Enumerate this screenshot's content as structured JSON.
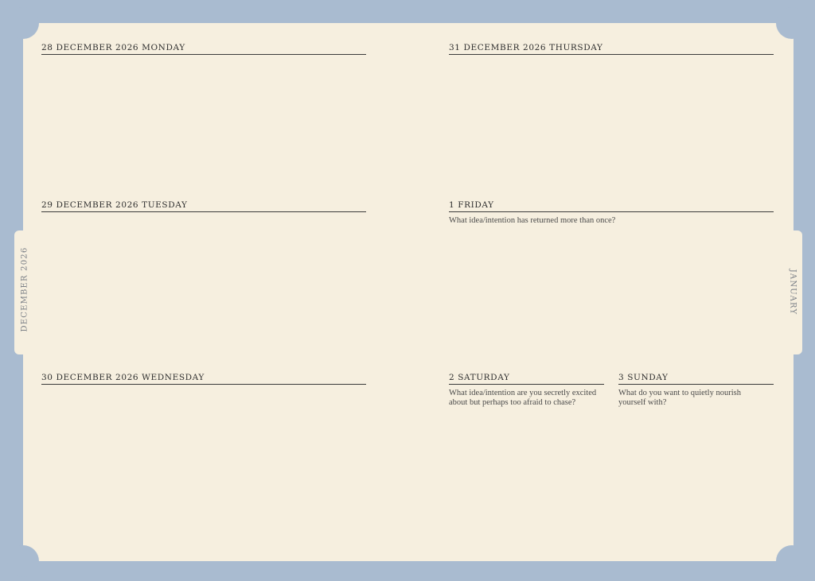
{
  "side_tabs": {
    "left": "DECEMBER 2026",
    "right": "JANUARY"
  },
  "days": {
    "mon": "28 DECEMBER 2026 MONDAY",
    "tue": "29 DECEMBER 2026 TUESDAY",
    "wed": "30 DECEMBER 2026 WEDNESDAY",
    "thu": "31 DECEMBER 2026 THURSDAY",
    "fri": "1 FRIDAY",
    "sat": "2 SATURDAY",
    "sun": "3 SUNDAY"
  },
  "prompts": {
    "fri": "What idea/intention has returned more than once?",
    "sat": "What idea/intention are you secretly excited about but perhaps too afraid to chase?",
    "sun": "What do you want to quietly nourish yourself with?"
  }
}
